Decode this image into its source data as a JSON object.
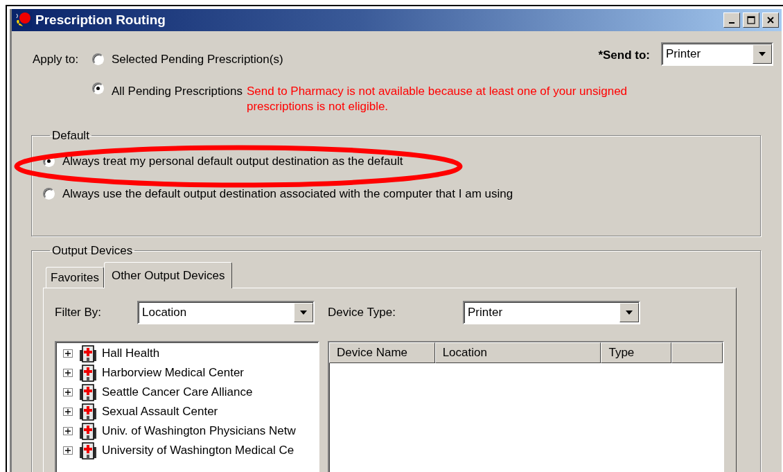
{
  "window": {
    "title": "Prescription Routing"
  },
  "apply_to": {
    "label": "Apply to:",
    "options": [
      {
        "label": "Selected Pending Prescription(s)",
        "selected": false
      },
      {
        "label": "All Pending Prescriptions",
        "selected": true
      }
    ]
  },
  "warning": "Send to Pharmacy is not available because at least one of your unsigned prescriptions is not eligible.",
  "send_to": {
    "label": "*Send to:",
    "value": "Printer"
  },
  "default_group": {
    "title": "Default",
    "options": [
      {
        "label": "Always treat my personal default output destination as the default",
        "selected": true
      },
      {
        "label": "Always use the default output destination associated with the computer that I am using",
        "selected": false
      }
    ]
  },
  "output_devices": {
    "title": "Output Devices",
    "tabs": [
      {
        "label": "Favorites",
        "selected": false
      },
      {
        "label": "Other Output Devices",
        "selected": true
      }
    ],
    "filter_by": {
      "label": "Filter By:",
      "value": "Location"
    },
    "device_type": {
      "label": "Device Type:",
      "value": "Printer"
    },
    "tree": [
      {
        "label": "Hall Health",
        "kind": "facility",
        "expanded": false
      },
      {
        "label": "Harborview Medical Center",
        "kind": "facility",
        "expanded": false
      },
      {
        "label": "Seattle Cancer Care Alliance",
        "kind": "facility",
        "expanded": false
      },
      {
        "label": "Sexual Assault Center",
        "kind": "facility",
        "expanded": false
      },
      {
        "label": "Univ. of Washington Physicians Netw",
        "kind": "facility",
        "expanded": false
      },
      {
        "label": "University of Washington Medical Ce",
        "kind": "facility",
        "expanded": false
      }
    ],
    "columns": [
      "Device Name",
      "Location",
      "Type"
    ]
  }
}
